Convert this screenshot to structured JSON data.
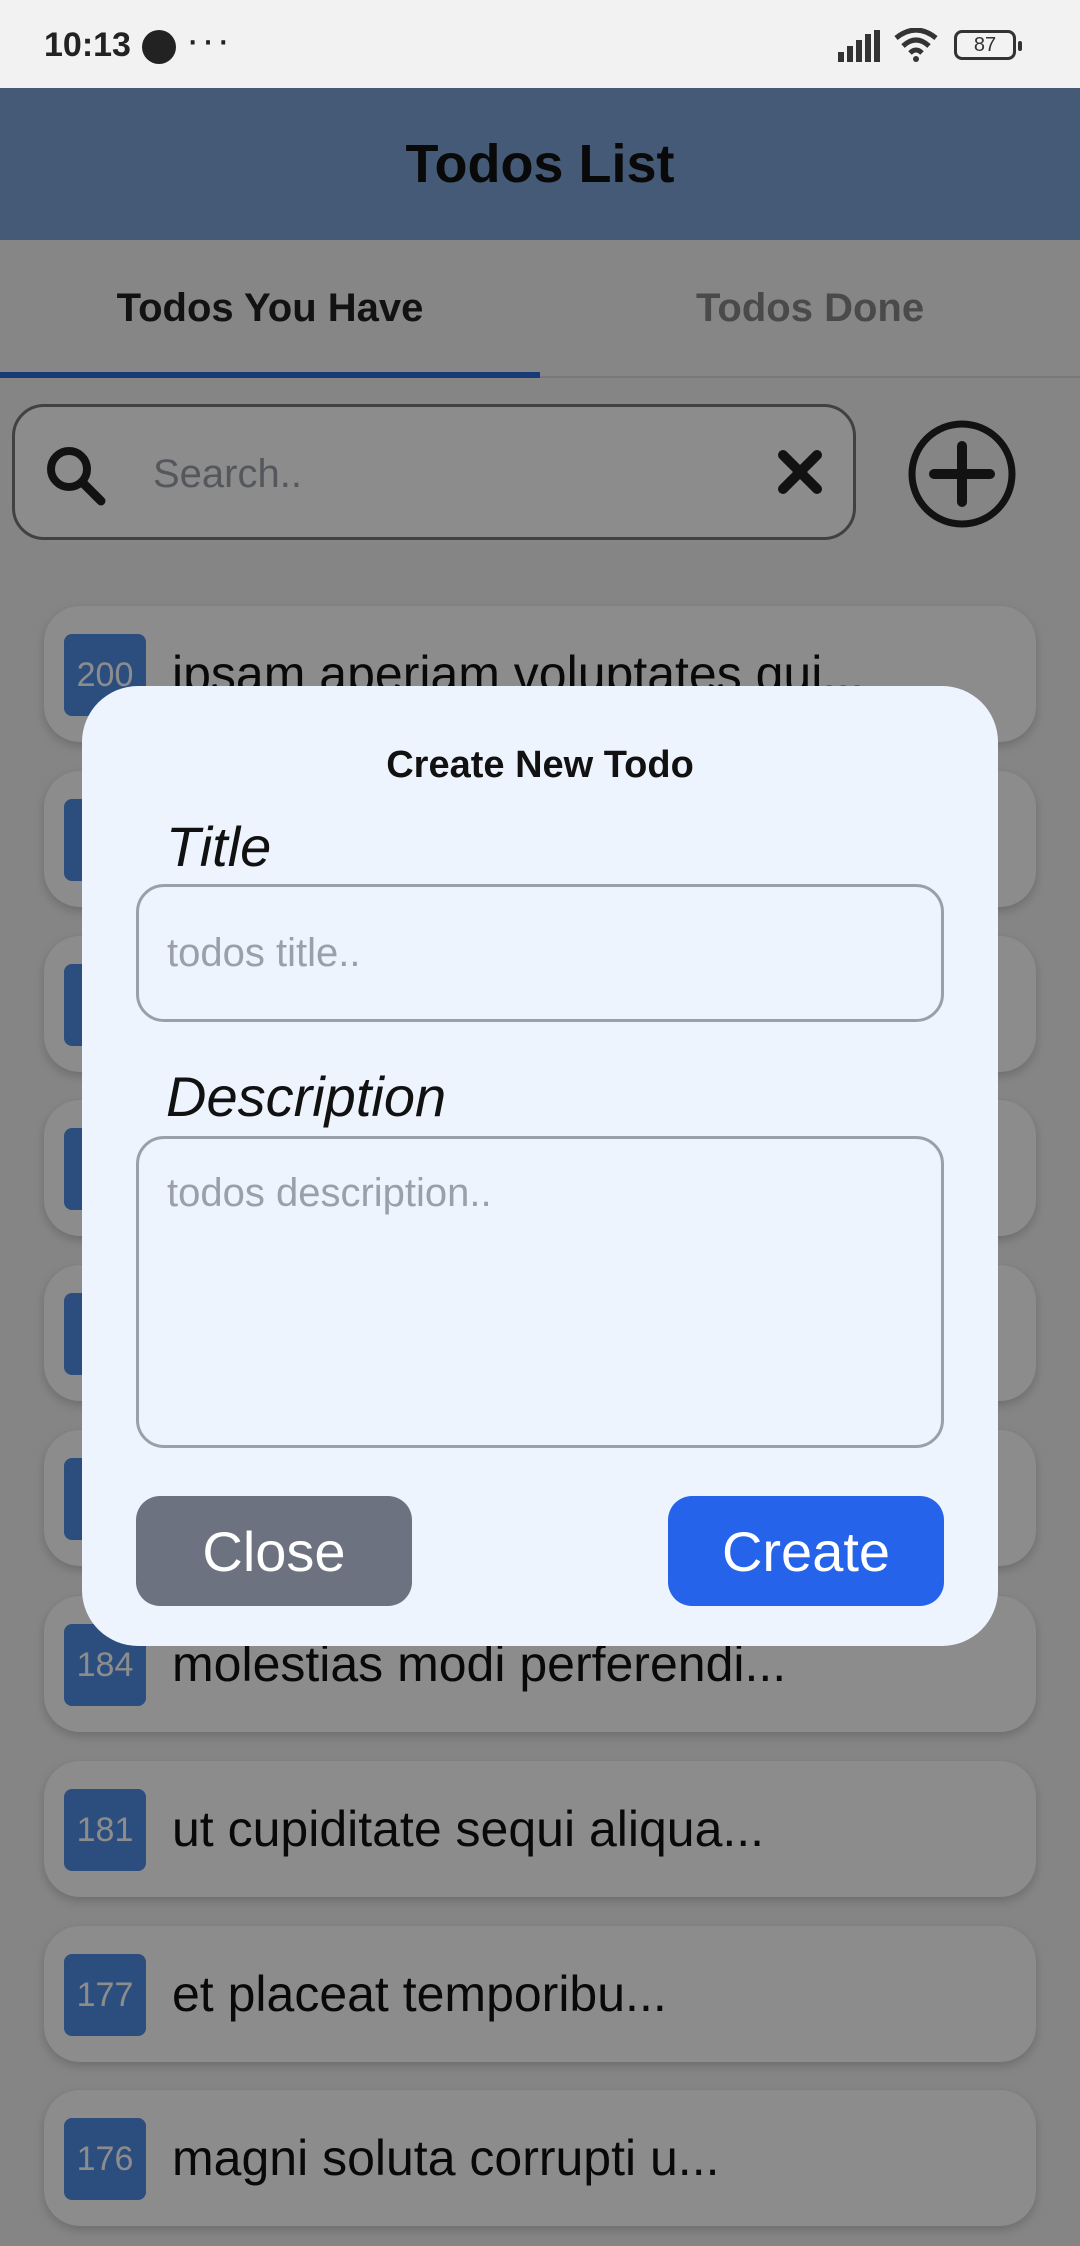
{
  "status_bar": {
    "time": "10:13",
    "dots": "···",
    "battery": "87"
  },
  "header": {
    "title": "Todos List"
  },
  "tabs": [
    {
      "label": "Todos You Have",
      "active": true
    },
    {
      "label": "Todos Done",
      "active": false
    }
  ],
  "search": {
    "placeholder": "Search..",
    "value": ""
  },
  "todos": [
    {
      "id": "200",
      "title": "ipsam aperiam voluptates qui..."
    },
    {
      "id": "",
      "title": ""
    },
    {
      "id": "",
      "title": ""
    },
    {
      "id": "",
      "title": ""
    },
    {
      "id": "",
      "title": ""
    },
    {
      "id": "",
      "title": ""
    },
    {
      "id": "184",
      "title": "molestias modi perferendi..."
    },
    {
      "id": "181",
      "title": "ut cupiditate sequi aliqua..."
    },
    {
      "id": "177",
      "title": "et placeat temporibu..."
    },
    {
      "id": "176",
      "title": "magni soluta corrupti u..."
    }
  ],
  "modal": {
    "heading": "Create New Todo",
    "title_label": "Title",
    "title_placeholder": "todos title..",
    "description_label": "Description",
    "description_placeholder": "todos description..",
    "close_label": "Close",
    "create_label": "Create"
  },
  "colors": {
    "header_bg": "#7fa5d8",
    "accent": "#2563eb",
    "id_badge": "#4f8fe6",
    "close_button": "#6c7280"
  },
  "icons": {
    "search": "search-icon",
    "clear": "close-icon",
    "add": "plus-circle-icon"
  }
}
